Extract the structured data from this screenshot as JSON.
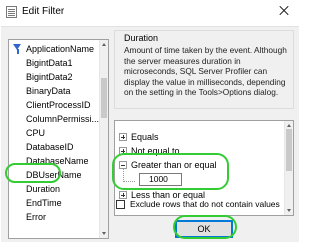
{
  "window": {
    "title": "Edit Filter"
  },
  "columns": {
    "items": [
      "ApplicationName",
      "BigintData1",
      "BigintData2",
      "BinaryData",
      "ClientProcessID",
      "ColumnPermissi...",
      "CPU",
      "DatabaseID",
      "DatabaseName",
      "DBUserName",
      "Duration",
      "EndTime",
      "Error"
    ],
    "selected": "Duration"
  },
  "description": {
    "title": "Duration",
    "text": "Amount of time taken by the event. Although the server measures duration in microseconds, SQL Server Profiler can display the value in milliseconds, depending on the setting in the Tools>Options dialog."
  },
  "filter_tree": {
    "operators": [
      {
        "label": "Equals",
        "expanded": false
      },
      {
        "label": "Not equal to",
        "expanded": false
      },
      {
        "label": "Greater than or equal",
        "expanded": true
      },
      {
        "label": "Less than or equal",
        "expanded": false
      }
    ],
    "value": "1000"
  },
  "options": {
    "exclude_label": "Exclude rows that do not contain values",
    "exclude_checked": false
  },
  "buttons": {
    "ok_label": "OK"
  },
  "colors": {
    "highlight": "#33cc33",
    "accent": "#0078d7"
  }
}
